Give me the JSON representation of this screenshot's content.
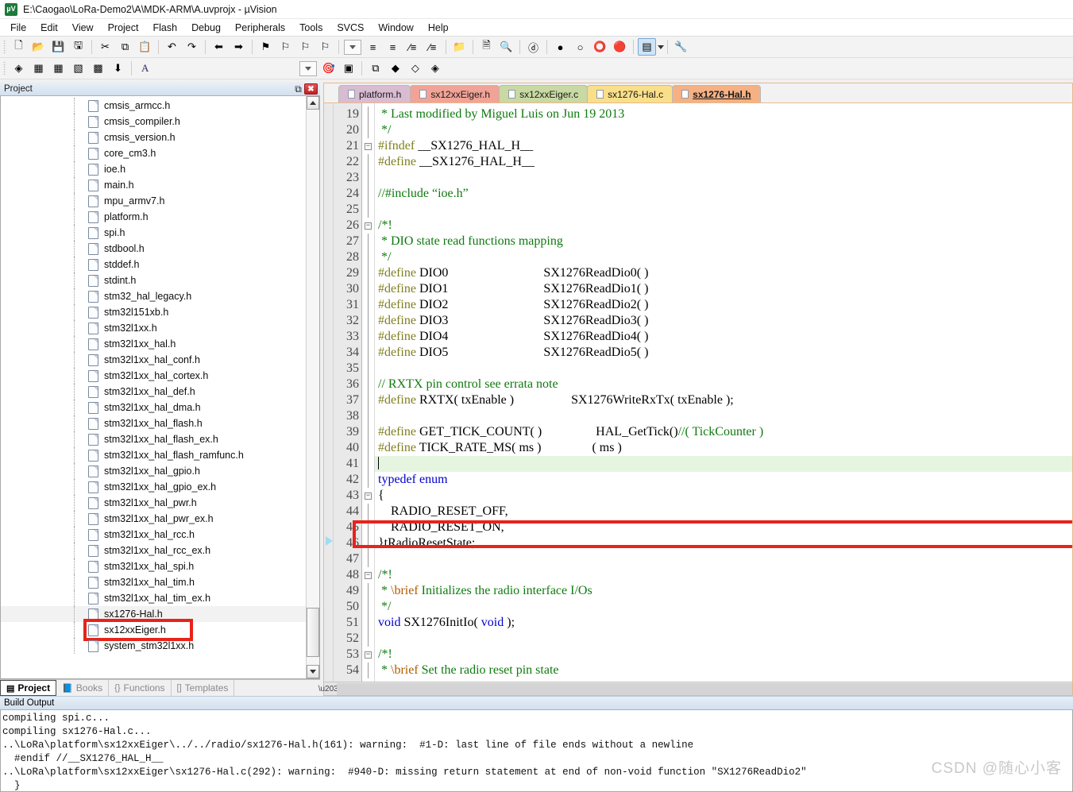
{
  "window": {
    "title": "E:\\Caogao\\LoRa-Demo2\\A\\MDK-ARM\\A.uvprojx - µVision",
    "logo_text": "µV"
  },
  "menu": [
    "File",
    "Edit",
    "View",
    "Project",
    "Flash",
    "Debug",
    "Peripherals",
    "Tools",
    "SVCS",
    "Window",
    "Help"
  ],
  "toolbar1": [
    {
      "name": "new-file-icon",
      "glyph": "🗋"
    },
    {
      "name": "open-file-icon",
      "glyph": "📂"
    },
    {
      "name": "save-icon",
      "glyph": "💾"
    },
    {
      "name": "save-all-icon",
      "glyph": "🖫"
    },
    {
      "name": "cut-icon",
      "glyph": "✂"
    },
    {
      "name": "copy-icon",
      "glyph": "⧉"
    },
    {
      "name": "paste-icon",
      "glyph": "📋"
    },
    {
      "name": "undo-icon",
      "glyph": "↶"
    },
    {
      "name": "redo-icon",
      "glyph": "↷"
    },
    {
      "name": "navigate-back-icon",
      "glyph": "⬅"
    },
    {
      "name": "navigate-forward-icon",
      "glyph": "➡"
    },
    {
      "name": "bookmark-toggle-icon",
      "glyph": "⚑"
    },
    {
      "name": "bookmark-prev-icon",
      "glyph": "⚐"
    },
    {
      "name": "bookmark-next-icon",
      "glyph": "⚐"
    },
    {
      "name": "bookmark-clear-icon",
      "glyph": "⚐"
    },
    {
      "name": "indent-increase-icon",
      "glyph": "≡"
    },
    {
      "name": "indent-decrease-icon",
      "glyph": "≡"
    },
    {
      "name": "comment-lines-icon",
      "glyph": "∕≡"
    },
    {
      "name": "uncomment-lines-icon",
      "glyph": "∕≡"
    },
    {
      "name": "open-folder-icon",
      "glyph": "📁"
    },
    {
      "name": "find-in-files-icon",
      "glyph": "🗎"
    },
    {
      "name": "find-next-icon",
      "glyph": "🔍"
    },
    {
      "name": "debug-session-icon",
      "glyph": "ⓓ"
    },
    {
      "name": "insert-breakpoint-icon",
      "glyph": "●"
    },
    {
      "name": "disable-breakpoint-icon",
      "glyph": "○"
    },
    {
      "name": "kill-all-breakpoints-icon",
      "glyph": "⭕"
    },
    {
      "name": "disable-all-breakpoints-icon",
      "glyph": "🔴"
    },
    {
      "name": "project-window-icon",
      "glyph": "▤"
    },
    {
      "name": "configure-icon",
      "glyph": "🔧"
    }
  ],
  "toolbar2": [
    {
      "name": "translate-file-icon",
      "glyph": "◈"
    },
    {
      "name": "build-target-icon",
      "glyph": "▦"
    },
    {
      "name": "rebuild-all-icon",
      "glyph": "▦"
    },
    {
      "name": "batch-build-icon",
      "glyph": "▧"
    },
    {
      "name": "stop-build-icon",
      "glyph": "▩"
    },
    {
      "name": "download-icon",
      "glyph": "⬇"
    }
  ],
  "toolbar2_target": {
    "label": "A",
    "name": "target-selector"
  },
  "toolbar2_right": [
    {
      "name": "target-options-icon",
      "glyph": "🎯"
    },
    {
      "name": "manage-project-items-icon",
      "glyph": "▣"
    },
    {
      "name": "multi-project-icon",
      "glyph": "⧉"
    },
    {
      "name": "pack-installer-icon",
      "glyph": "◆"
    },
    {
      "name": "manage-run-time-icon",
      "glyph": "◇"
    },
    {
      "name": "select-software-packs-icon",
      "glyph": "◈"
    }
  ],
  "project_panel": {
    "caption": "Project",
    "pin_glyph": "⧉",
    "close_glyph": "✖",
    "selected_file": "sx1276-Hal.h",
    "highlighted_file": "sx12xxEiger.h",
    "files": [
      "cmsis_armcc.h",
      "cmsis_compiler.h",
      "cmsis_version.h",
      "core_cm3.h",
      "ioe.h",
      "main.h",
      "mpu_armv7.h",
      "platform.h",
      "spi.h",
      "stdbool.h",
      "stddef.h",
      "stdint.h",
      "stm32_hal_legacy.h",
      "stm32l151xb.h",
      "stm32l1xx.h",
      "stm32l1xx_hal.h",
      "stm32l1xx_hal_conf.h",
      "stm32l1xx_hal_cortex.h",
      "stm32l1xx_hal_def.h",
      "stm32l1xx_hal_dma.h",
      "stm32l1xx_hal_flash.h",
      "stm32l1xx_hal_flash_ex.h",
      "stm32l1xx_hal_flash_ramfunc.h",
      "stm32l1xx_hal_gpio.h",
      "stm32l1xx_hal_gpio_ex.h",
      "stm32l1xx_hal_pwr.h",
      "stm32l1xx_hal_pwr_ex.h",
      "stm32l1xx_hal_rcc.h",
      "stm32l1xx_hal_rcc_ex.h",
      "stm32l1xx_hal_spi.h",
      "stm32l1xx_hal_tim.h",
      "stm32l1xx_hal_tim_ex.h",
      "sx1276-Hal.h",
      "sx12xxEiger.h",
      "system_stm32l1xx.h"
    ],
    "bottom_tabs": [
      {
        "label": "Project",
        "icon": "▤",
        "active": true
      },
      {
        "label": "Books",
        "icon": "📘",
        "active": false
      },
      {
        "label": "Functions",
        "icon": "{}",
        "active": false
      },
      {
        "label": "Templates",
        "icon": "[]",
        "active": false
      }
    ]
  },
  "editor": {
    "tabs": [
      {
        "label": "platform.h",
        "color": "#d9bcd2",
        "active": false
      },
      {
        "label": "sx12xxEiger.h",
        "color": "#f0a396",
        "active": false
      },
      {
        "label": "sx12xxEiger.c",
        "color": "#c8d9a3",
        "active": false
      },
      {
        "label": "sx1276-Hal.c",
        "color": "#fadf8a",
        "active": false
      },
      {
        "label": "sx1276-Hal.h",
        "color": "#f5b183",
        "active": true
      }
    ],
    "first_line_number": 19,
    "current_line": 41,
    "lines": [
      {
        "n": 19,
        "fold": "bar",
        "segs": [
          {
            "t": " * Last modified by Miguel Luis on Jun 19 2013",
            "c": "cm"
          }
        ]
      },
      {
        "n": 20,
        "fold": "end",
        "segs": [
          {
            "t": " */",
            "c": "cm"
          }
        ]
      },
      {
        "n": 21,
        "fold": "minus",
        "segs": [
          {
            "t": "#ifndef",
            "c": "pp"
          },
          {
            "t": " __SX1276_HAL_H__",
            "c": "pl"
          }
        ]
      },
      {
        "n": 22,
        "fold": "bar",
        "segs": [
          {
            "t": "#define",
            "c": "pp"
          },
          {
            "t": " __SX1276_HAL_H__",
            "c": "pl"
          }
        ]
      },
      {
        "n": 23,
        "fold": "bar",
        "segs": [
          {
            "t": "",
            "c": "pl"
          }
        ]
      },
      {
        "n": 24,
        "fold": "bar",
        "segs": [
          {
            "t": "//#include ",
            "c": "cm"
          },
          {
            "t": "“ioe.h”",
            "c": "cm"
          }
        ]
      },
      {
        "n": 25,
        "fold": "bar",
        "segs": [
          {
            "t": "",
            "c": "pl"
          }
        ]
      },
      {
        "n": 26,
        "fold": "minus",
        "segs": [
          {
            "t": "/*!",
            "c": "cm"
          }
        ]
      },
      {
        "n": 27,
        "fold": "bar",
        "segs": [
          {
            "t": " * DIO state read functions mapping",
            "c": "cm"
          }
        ]
      },
      {
        "n": 28,
        "fold": "end",
        "segs": [
          {
            "t": " */",
            "c": "cm"
          }
        ]
      },
      {
        "n": 29,
        "fold": "bar",
        "segs": [
          {
            "t": "#define",
            "c": "pp"
          },
          {
            "t": " DIO0                              SX1276ReadDio0( )",
            "c": "pl"
          }
        ]
      },
      {
        "n": 30,
        "fold": "bar",
        "segs": [
          {
            "t": "#define",
            "c": "pp"
          },
          {
            "t": " DIO1                              SX1276ReadDio1( )",
            "c": "pl"
          }
        ]
      },
      {
        "n": 31,
        "fold": "bar",
        "segs": [
          {
            "t": "#define",
            "c": "pp"
          },
          {
            "t": " DIO2                              SX1276ReadDio2( )",
            "c": "pl"
          }
        ]
      },
      {
        "n": 32,
        "fold": "bar",
        "segs": [
          {
            "t": "#define",
            "c": "pp"
          },
          {
            "t": " DIO3                              SX1276ReadDio3( )",
            "c": "pl"
          }
        ]
      },
      {
        "n": 33,
        "fold": "bar",
        "segs": [
          {
            "t": "#define",
            "c": "pp"
          },
          {
            "t": " DIO4                              SX1276ReadDio4( )",
            "c": "pl"
          }
        ]
      },
      {
        "n": 34,
        "fold": "bar",
        "segs": [
          {
            "t": "#define",
            "c": "pp"
          },
          {
            "t": " DIO5                              SX1276ReadDio5( )",
            "c": "pl"
          }
        ]
      },
      {
        "n": 35,
        "fold": "bar",
        "segs": [
          {
            "t": "",
            "c": "pl"
          }
        ]
      },
      {
        "n": 36,
        "fold": "bar",
        "segs": [
          {
            "t": "// RXTX pin control see errata note",
            "c": "cm"
          }
        ]
      },
      {
        "n": 37,
        "fold": "bar",
        "segs": [
          {
            "t": "#define",
            "c": "pp"
          },
          {
            "t": " RXTX( txEnable )                  SX1276WriteRxTx( txEnable );",
            "c": "pl"
          }
        ]
      },
      {
        "n": 38,
        "fold": "bar",
        "segs": [
          {
            "t": "",
            "c": "pl"
          }
        ]
      },
      {
        "n": 39,
        "fold": "bar",
        "segs": [
          {
            "t": "#define",
            "c": "pp"
          },
          {
            "t": " GET_TICK_COUNT( )                 HAL_GetTick()",
            "c": "pl"
          },
          {
            "t": "//( TickCounter )",
            "c": "cm"
          }
        ]
      },
      {
        "n": 40,
        "fold": "bar",
        "segs": [
          {
            "t": "#define",
            "c": "pp"
          },
          {
            "t": " TICK_RATE_MS( ms )                ( ms )",
            "c": "pl"
          }
        ]
      },
      {
        "n": 41,
        "fold": "bar",
        "segs": [
          {
            "t": "",
            "c": "pl"
          }
        ],
        "current": true
      },
      {
        "n": 42,
        "fold": "bar",
        "segs": [
          {
            "t": "typedef enum",
            "c": "kw"
          }
        ]
      },
      {
        "n": 43,
        "fold": "minus",
        "segs": [
          {
            "t": "{",
            "c": "pl"
          }
        ]
      },
      {
        "n": 44,
        "fold": "bar",
        "segs": [
          {
            "t": "    RADIO_RESET_OFF,",
            "c": "pl"
          }
        ]
      },
      {
        "n": 45,
        "fold": "bar",
        "segs": [
          {
            "t": "    RADIO_RESET_ON,",
            "c": "pl"
          }
        ]
      },
      {
        "n": 46,
        "fold": "bar",
        "segs": [
          {
            "t": "}tRadioResetState;",
            "c": "pl"
          }
        ]
      },
      {
        "n": 47,
        "fold": "end",
        "segs": [
          {
            "t": "",
            "c": "pl"
          }
        ]
      },
      {
        "n": 48,
        "fold": "minus",
        "segs": [
          {
            "t": "/*!",
            "c": "cm"
          }
        ]
      },
      {
        "n": 49,
        "fold": "bar",
        "segs": [
          {
            "t": " * ",
            "c": "cm"
          },
          {
            "t": "\\brief",
            "c": "cmbrief"
          },
          {
            "t": " Initializes the radio interface I/Os",
            "c": "cm"
          }
        ]
      },
      {
        "n": 50,
        "fold": "end",
        "segs": [
          {
            "t": " */",
            "c": "cm"
          }
        ]
      },
      {
        "n": 51,
        "fold": "bar",
        "segs": [
          {
            "t": "void",
            "c": "kw"
          },
          {
            "t": " SX1276InitIo( ",
            "c": "pl"
          },
          {
            "t": "void",
            "c": "kw"
          },
          {
            "t": " );",
            "c": "pl"
          }
        ]
      },
      {
        "n": 52,
        "fold": "bar",
        "segs": [
          {
            "t": "",
            "c": "pl"
          }
        ]
      },
      {
        "n": 53,
        "fold": "minus",
        "segs": [
          {
            "t": "/*!",
            "c": "cm"
          }
        ]
      },
      {
        "n": 54,
        "fold": "bar",
        "segs": [
          {
            "t": " * ",
            "c": "cm"
          },
          {
            "t": "\\brief",
            "c": "cmbrief"
          },
          {
            "t": " Set the radio reset pin state",
            "c": "cm"
          }
        ]
      }
    ]
  },
  "build_output": {
    "caption": "Build Output",
    "lines": [
      "compiling spi.c...",
      "compiling sx1276-Hal.c...",
      "..\\LoRa\\platform\\sx12xxEiger\\../../radio/sx1276-Hal.h(161): warning:  #1-D: last line of file ends without a newline",
      "  #endif //__SX1276_HAL_H__",
      "..\\LoRa\\platform\\sx12xxEiger\\sx1276-Hal.c(292): warning:  #940-D: missing return statement at end of non-void function \"SX1276ReadDio2\"",
      "  }"
    ]
  },
  "watermark": "CSDN @随心小客",
  "colors": {
    "redbox": "#e8231a",
    "current_line": "#e6f5e0",
    "editor_border": "#e8b98f"
  }
}
